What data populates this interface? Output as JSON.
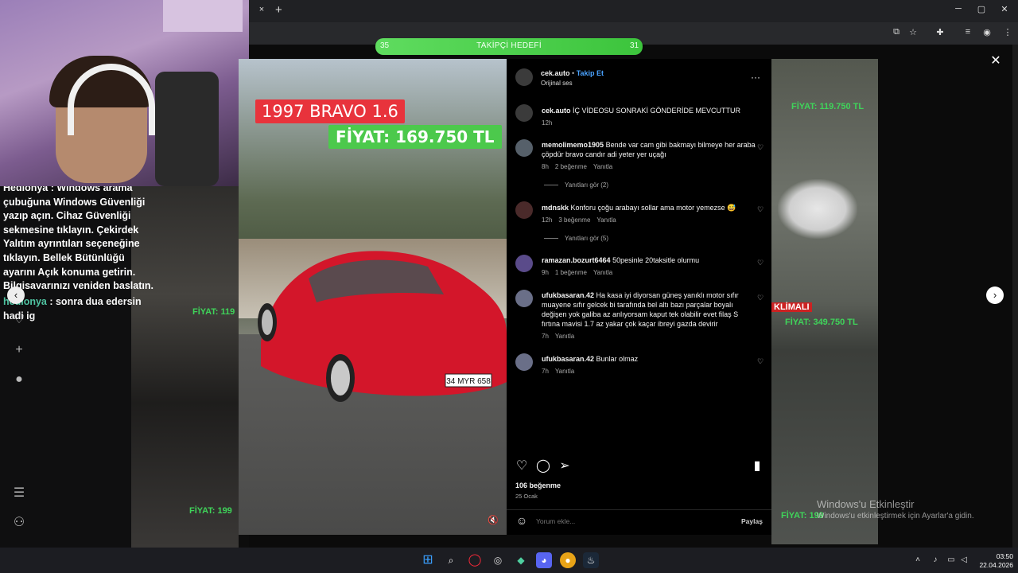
{
  "browser": {
    "tab_close": "×",
    "new_tab": "+",
    "window_controls": [
      "─",
      "▢",
      "✕"
    ],
    "toolbar_icons": [
      "tab-search-icon",
      "star-icon",
      "extensions-icon",
      "media-icon",
      "profile-icon",
      "menu-icon"
    ]
  },
  "goal_bar": {
    "left_value": "35",
    "label": "TAKİPÇİ HEDEFİ",
    "right_value": "31",
    "fill_fraction": 1.0
  },
  "stream": {
    "chat_message_1": "Hedionya : Windows arama çubuğuna Windows Güvenliği yazıp açın. Cihaz Güvenliği sekmesine tıklayın. Çekirdek Yalıtım ayrıntıları seçeneğine tıklayın. Bellek Bütünlüğü ayarını Açık konuma getirin. Bilgisayarınızı yeniden başlatın.",
    "chat_message_2_user": "hedionya",
    "chat_message_2_text": " : sonra dua edersin hadi ig"
  },
  "video": {
    "title_badge": "1997 BRAVO 1.6",
    "price_badge": "FİYAT: 169.750 TL",
    "plate": "34 MYR 658"
  },
  "background": {
    "price_1": "FİYAT: 119.750 TL",
    "price_2": "FİYAT: 349.750 TL",
    "price_3": "FİYAT: 119",
    "price_4": "FİYAT: 199",
    "price_5": "FİYAT: 199",
    "klimali": "KLİMALI"
  },
  "post": {
    "author": "cek.auto",
    "follow_label": "Takip Et",
    "audio": "Orijinal ses",
    "more": "···",
    "caption_user": "cek.auto",
    "caption_text": "İÇ VİDEOSU SONRAKİ GÖNDERİDE MEVCUTTUR",
    "caption_time": "12h",
    "comments": [
      {
        "user": "memolimemo1905",
        "text": "Bende var cam gibi bakmayı bilmeye her araba çöpdür bravo candır adi yeter yer uçağı",
        "time": "8h",
        "likes": "2 beğenme",
        "reply": "Yanıtla",
        "see_replies": "Yanıtları gör (2)"
      },
      {
        "user": "mdnskk",
        "text": "Konforu çoğu arabayı sollar ama motor yemezse 😅",
        "time": "12h",
        "likes": "3 beğenme",
        "reply": "Yanıtla",
        "see_replies": "Yanıtları gör (5)"
      },
      {
        "user": "ramazan.bozurt6464",
        "text": "50pesinle 20taksitle olurmu",
        "time": "9h",
        "likes": "1 beğenme",
        "reply": "Yanıtla"
      },
      {
        "user": "ufukbasaran.42",
        "text": "Ha kasa iyi diyorsan güneş yanıklı motor sıfır muayene sıfır gelcek bi tarafında bel altı bazı parçalar boyalı değişen yok galiba az anlıyorsam kaput tek olabilir evet filaş S fırtına mavisi 1.7 az yakar çok kaçar ibreyi gazda devirir",
        "time": "7h",
        "reply": "Yanıtla"
      },
      {
        "user": "ufukbasaran.42",
        "text": "Bunlar olmaz",
        "time": "7h",
        "reply": "Yanıtla"
      }
    ],
    "likes_count": "106 beğenme",
    "date": "25 Ocak",
    "comment_placeholder": "Yorum ekle...",
    "share_label": "Paylaş"
  },
  "watermark": {
    "title": "Windows'u Etkinleştir",
    "subtitle": "Windows'u etkinleştirmek için Ayarlar'a gidin."
  },
  "taskbar": {
    "icons": [
      "windows-start-icon",
      "search-icon",
      "opera-icon",
      "recorder-icon",
      "vpn-icon",
      "discord-icon",
      "chrome-icon",
      "steam-icon"
    ],
    "time": "03:50",
    "date": "22.04.2026"
  }
}
